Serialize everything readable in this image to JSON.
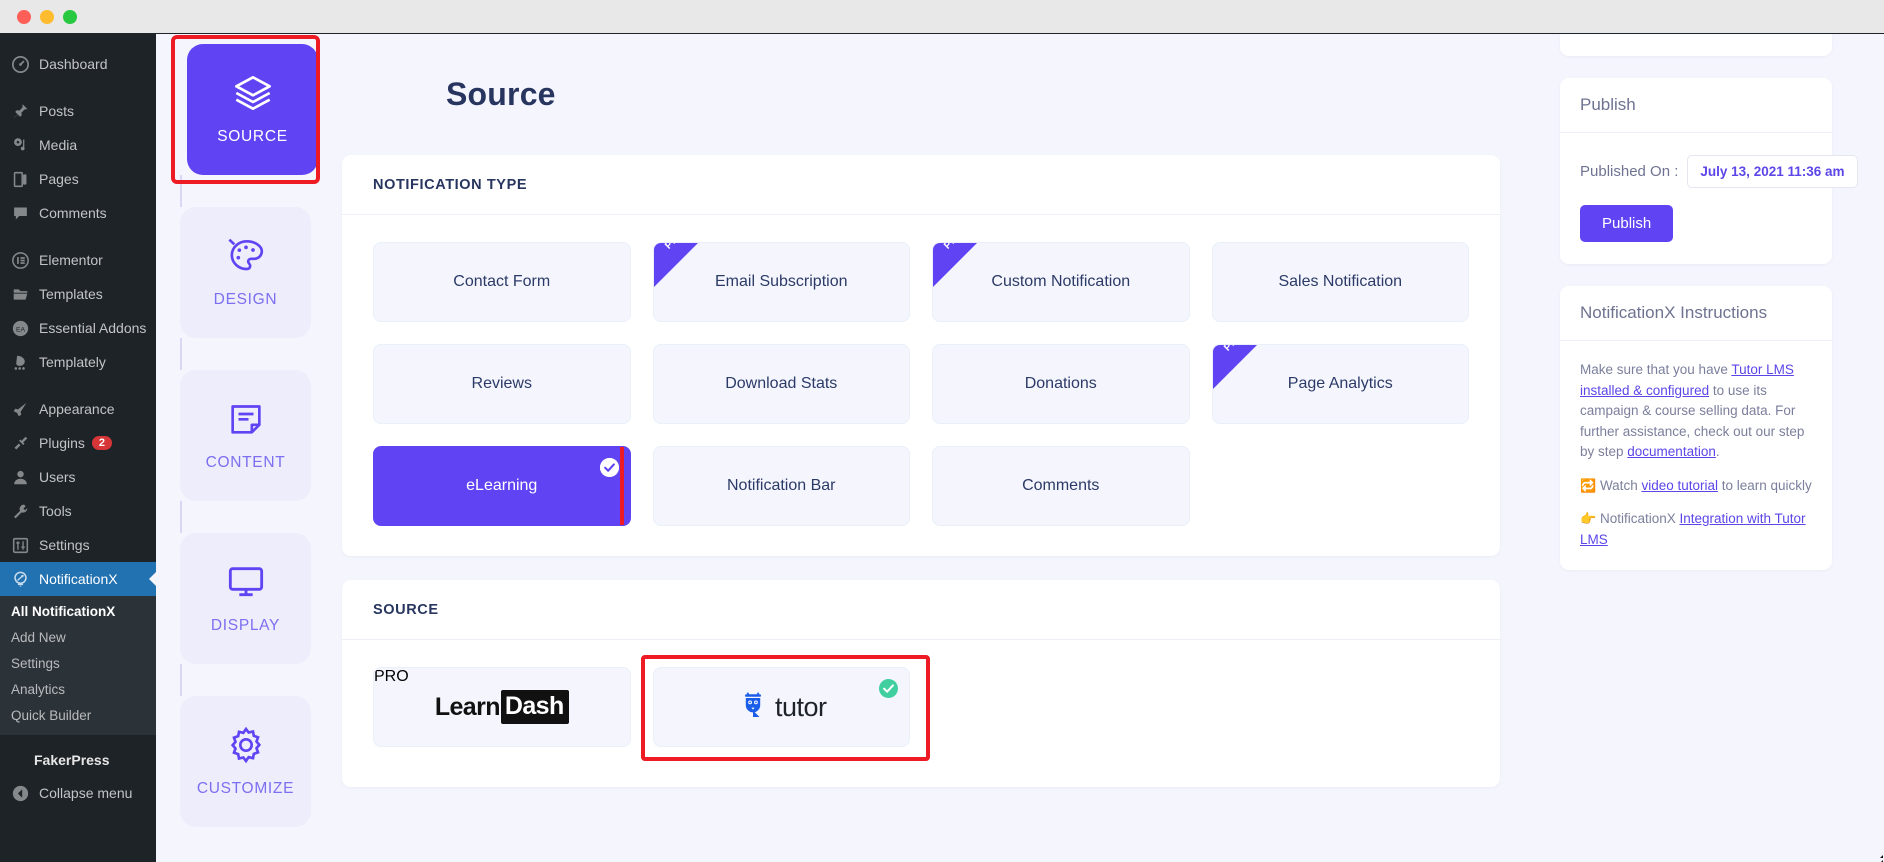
{
  "window": {
    "traffic_lights": [
      "close",
      "minimize",
      "maximize"
    ]
  },
  "wp_sidebar": {
    "items": [
      {
        "label": "Dashboard",
        "icon": "dashboard-icon"
      },
      {
        "label": "Posts",
        "icon": "pin-icon"
      },
      {
        "label": "Media",
        "icon": "media-icon"
      },
      {
        "label": "Pages",
        "icon": "pages-icon"
      },
      {
        "label": "Comments",
        "icon": "comments-icon"
      },
      {
        "label": "Elementor",
        "icon": "elementor-icon"
      },
      {
        "label": "Templates",
        "icon": "folder-icon"
      },
      {
        "label": "Essential Addons",
        "icon": "essential-addons-icon"
      },
      {
        "label": "Templately",
        "icon": "templately-icon"
      },
      {
        "label": "Appearance",
        "icon": "brush-icon"
      },
      {
        "label": "Plugins",
        "icon": "plug-icon",
        "badge": "2"
      },
      {
        "label": "Users",
        "icon": "user-icon"
      },
      {
        "label": "Tools",
        "icon": "wrench-icon"
      },
      {
        "label": "Settings",
        "icon": "settings-icon"
      },
      {
        "label": "NotificationX",
        "icon": "notificationx-icon",
        "active": true
      }
    ],
    "submenu": [
      {
        "label": "All NotificationX",
        "current": true
      },
      {
        "label": "Add New"
      },
      {
        "label": "Settings"
      },
      {
        "label": "Analytics"
      },
      {
        "label": "Quick Builder"
      }
    ],
    "fakerpress_label": "FakerPress",
    "collapse_label": "Collapse menu"
  },
  "steps": [
    {
      "label": "SOURCE",
      "icon": "layers-icon",
      "active": true,
      "highlighted": true
    },
    {
      "label": "DESIGN",
      "icon": "palette-icon",
      "active": false
    },
    {
      "label": "CONTENT",
      "icon": "document-icon",
      "active": false
    },
    {
      "label": "DISPLAY",
      "icon": "monitor-icon",
      "active": false
    },
    {
      "label": "CUSTOMIZE",
      "icon": "gear-icon",
      "active": false
    }
  ],
  "page_title": "Source",
  "notification_type": {
    "heading": "NOTIFICATION TYPE",
    "cards": [
      {
        "label": "Contact Form",
        "pro": false,
        "selected": false
      },
      {
        "label": "Email Subscription",
        "pro": true,
        "selected": false
      },
      {
        "label": "Custom Notification",
        "pro": true,
        "selected": false
      },
      {
        "label": "Sales Notification",
        "pro": false,
        "selected": false
      },
      {
        "label": "Reviews",
        "pro": false,
        "selected": false
      },
      {
        "label": "Download Stats",
        "pro": false,
        "selected": false
      },
      {
        "label": "Donations",
        "pro": false,
        "selected": false
      },
      {
        "label": "Page Analytics",
        "pro": true,
        "selected": false
      },
      {
        "label": "eLearning",
        "pro": false,
        "selected": true,
        "highlighted": true
      },
      {
        "label": "Notification Bar",
        "pro": false,
        "selected": false
      },
      {
        "label": "Comments",
        "pro": false,
        "selected": false
      }
    ],
    "pro_badge_label": "PRO"
  },
  "source_section": {
    "heading": "SOURCE",
    "cards": [
      {
        "name": "LearnDash",
        "logo": "learndash-logo",
        "logo_part1": "Learn",
        "logo_part2": "Dash",
        "pro": true,
        "selected": false
      },
      {
        "name": "Tutor LMS",
        "logo": "tutor-logo",
        "logo_text": "tutor",
        "pro": false,
        "selected": true,
        "highlighted": true
      }
    ]
  },
  "publish_panel": {
    "title": "Publish",
    "published_on_label": "Published On :",
    "published_on_value": "July 13, 2021 11:36 am",
    "publish_button": "Publish"
  },
  "instructions_panel": {
    "title": "NotificationX Instructions",
    "p1_before": "Make sure that you have ",
    "p1_link1": "Tutor LMS installed & configured",
    "p1_mid": " to use its campaign & course selling data. For further assistance, check out our step by step ",
    "p1_link2": "documentation",
    "p1_after": ".",
    "p2_icon": "video-icon",
    "p2_before": " Watch ",
    "p2_link": "video tutorial",
    "p2_after": " to learn quickly",
    "p3_icon": "pointing-hand-icon",
    "p3_before": " NotificationX ",
    "p3_link": "Integration with Tutor LMS"
  },
  "colors": {
    "accent_purple": "#6044f4",
    "highlight_red": "#ee1b24",
    "page_bg": "#f5f5fd",
    "card_bg": "#f5f6fd",
    "title_navy": "#27355f",
    "wp_dark": "#1d2327",
    "wp_active_blue": "#2271b1",
    "badge_red": "#d63638",
    "check_green": "#41cfa0",
    "tutor_blue": "#1a5de8"
  }
}
